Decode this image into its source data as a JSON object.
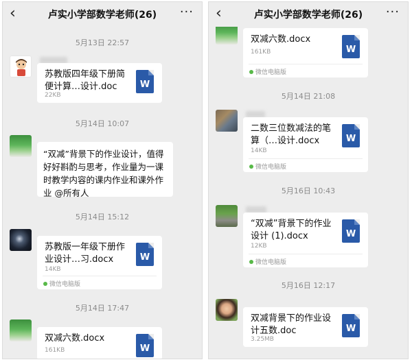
{
  "header": {
    "back_icon": "‹",
    "title": "卢实小学部数学老师(26)",
    "more_icon": "···"
  },
  "left": {
    "timestamps": [
      "5月13日 22:57",
      "5月14日 10:07",
      "5月14日 15:12",
      "5月14日 17:47"
    ],
    "messages": [
      {
        "avatar": "cartoon-avatar",
        "file": "苏教版四年级下册简便计算…设计.doc",
        "size": "22KB"
      },
      {
        "avatar": "plant-avatar",
        "text": "“双减”背景下的作业设计，值得好好斟酌与思考，作业量为一课时教学内容的课内作业和课外作业 @所有人"
      },
      {
        "avatar": "dark-avatar",
        "file": "苏教版一年级下册作业设计…习.docx",
        "size": "14KB",
        "source": "微信电脑版"
      },
      {
        "avatar": "plant-avatar",
        "file": "双减六数.docx",
        "size": "161KB"
      }
    ]
  },
  "right": {
    "timestamps": [
      "5月14日 21:08",
      "5月16日 10:43",
      "5月16日 12:17"
    ],
    "messages": [
      {
        "avatar": "plant-avatar",
        "file": "双减六数.docx",
        "size": "161KB",
        "source": "微信电脑版"
      },
      {
        "avatar": "rocks-avatar",
        "file": "二数三位数减法的笔算（…设计.docx",
        "size": "14KB",
        "source": "微信电脑版"
      },
      {
        "avatar": "road-avatar",
        "file": "“双减”背景下的作业设计 (1).docx",
        "size": "12KB",
        "source": "微信电脑版"
      },
      {
        "avatar": "woman-avatar",
        "file": "双减背景下的作业设计五数.doc",
        "size": "3.25MB"
      }
    ]
  },
  "file_icon_letter": "W",
  "colors": {
    "background": "#ededed",
    "word_icon": "#2a5aa8",
    "source_dot": "#58b948"
  }
}
